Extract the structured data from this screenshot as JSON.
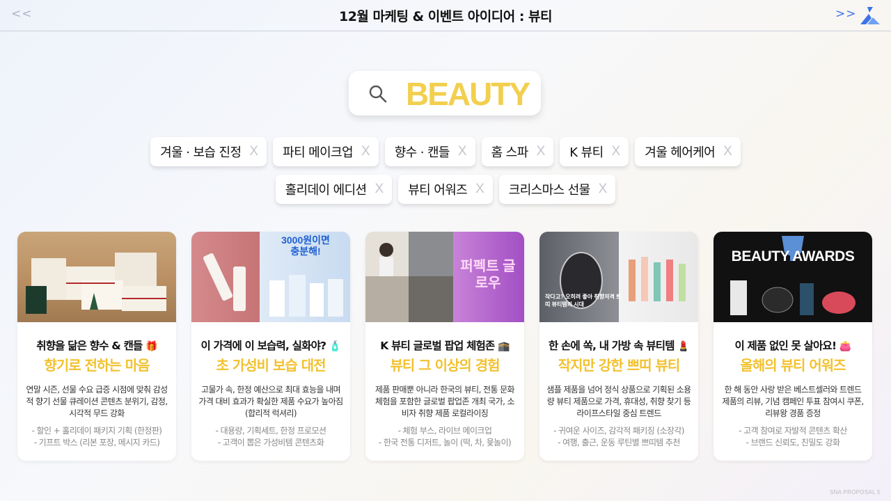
{
  "header": {
    "prev": "<<",
    "next": ">>",
    "title": "12월 마케팅 & 이벤트 아이디어 : 뷰티"
  },
  "search": {
    "term": "BEAUTY"
  },
  "tags_row1": [
    "겨울 · 보습 진정",
    "파티 메이크업",
    "향수 · 캔들",
    "홈 스파",
    "K 뷰티",
    "겨울 헤어케어"
  ],
  "tags_row2": [
    "홀리데이 에디션",
    "뷰티 어워즈",
    "크리스마스 선물"
  ],
  "tag_remove": "X",
  "cards": [
    {
      "title": "취향을 닮은 향수 & 캔들",
      "emoji": "🎁",
      "highlight": "향기로 전하는 마음",
      "desc": "연말 시즌, 선물 수요 급증 시점에 맞춰 감성적 향기 선물 큐레이션 콘텐츠 분위기, 감정, 시각적 무드 강화",
      "point1": "- 할인 + 홀리데이 패키지 기획 (한정판)",
      "point2": "- 기프트 박스 (리본 포장, 메시지 카드)"
    },
    {
      "title": "이 가격에 이 보습력, 실화야?",
      "emoji": "🧴",
      "highlight": "초 가성비 보습 대전",
      "desc": "고물가 속, 한정 예산으로 최대 효능을 내며 가격 대비 효과가 확실한 제품 수요가 높아짐 (합리적 럭셔리)",
      "point1": "- 대용량, 기획세트, 한정 프로모션",
      "point2": "- 고객이 뽑은 가성비템 콘텐츠화",
      "img_text": "3000원이면 충분해!"
    },
    {
      "title": "K 뷰티 글로벌 팝업 체험존",
      "emoji": "🕋",
      "highlight": "뷰티 그 이상의 경험",
      "desc": "제품 판매뿐 아니라 한국의 뷰티, 전통 문화 체험을 포함한 글로벌 팝업존 개최 국가, 소비자 취향 제품 로컬라이징",
      "point1": "- 체험 부스, 라이브 메이크업",
      "point2": "- 한국 전통 디저트, 놀이 (떡, 차, 윷놀이)",
      "img_text": "퍼펙트 글로우"
    },
    {
      "title": "한 손에 쏙, 내 가방 속 뷰티템",
      "emoji": "💄",
      "highlight": "작지만 강한 쁘띠 뷰티",
      "desc": "샘플 제품을 넘어 정식 상품으로 기획된 소용량 뷰티 제품으로 가격, 휴대성, 취향 찾기 등 라이프스타일 중심 트렌드",
      "point1": "- 귀여운 사이즈, 감각적 패키징 (소장각)",
      "point2": "- 여행, 출근, 운동 루틴별 쁘띠템 추천",
      "img_text": "작다고? 오히려 좋아 취향저격 쁘띠 뷰티템의 시대"
    },
    {
      "title": "이 제품 없인 못 살아요!",
      "emoji": "👛",
      "highlight": "올해의 뷰티 어워즈",
      "desc": "한 해 동안 사랑 받은 베스트셀러와 트렌드 제품의 리뷰, 기념 캠페인 투표 참여시 쿠폰, 리뷰왕 경품 증정",
      "point1": "- 고객 참여로 자발적 콘텐츠 확산",
      "point2": "- 브랜드 신뢰도, 친밀도 강화",
      "img_text": "BEAUTY AWARDS"
    }
  ],
  "footer": "SNA PROPOSAL   5",
  "colors": {
    "accent_yellow": "#f2c12e",
    "nav_blue": "#3d73e6"
  }
}
